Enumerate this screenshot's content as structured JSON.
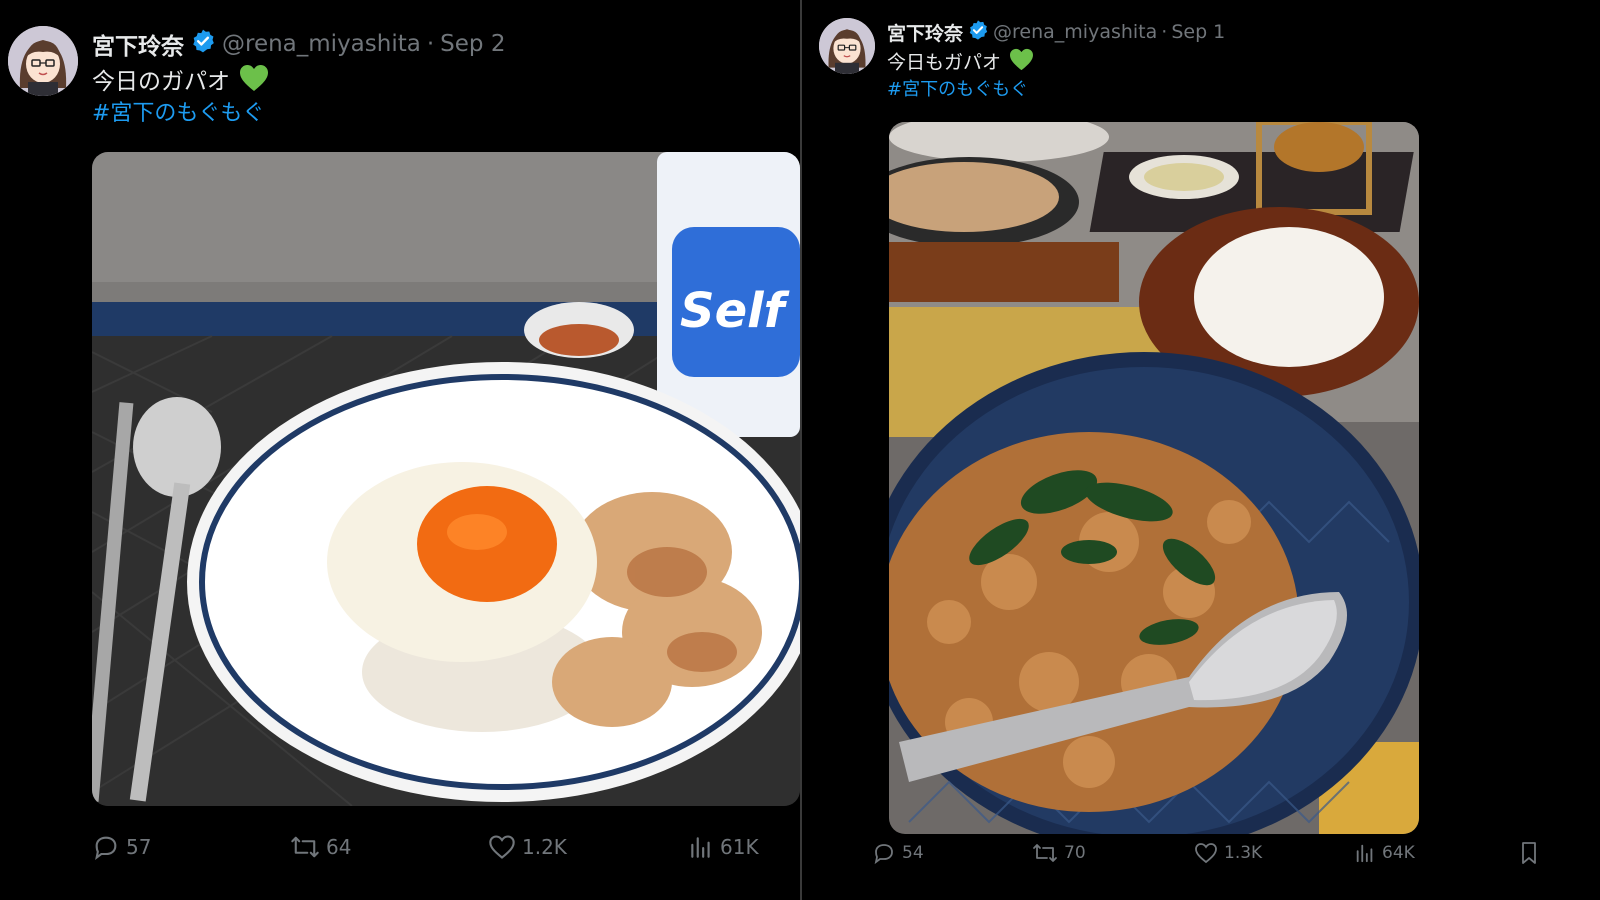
{
  "tweets": [
    {
      "author_name": "宮下玲奈",
      "handle": "@rena_miyashita",
      "separator": "·",
      "date": "Sep 2",
      "text": "今日のガパオ",
      "hashtag": "#宮下のもぐもぐ",
      "image_badge": "Self",
      "stats": {
        "replies": "57",
        "reposts": "64",
        "likes": "1.2K",
        "views": "61K"
      }
    },
    {
      "author_name": "宮下玲奈",
      "handle": "@rena_miyashita",
      "separator": "·",
      "date": "Sep 1",
      "text": "今日もガパオ",
      "hashtag": "#宮下のもぐもぐ",
      "stats": {
        "replies": "54",
        "reposts": "70",
        "likes": "1.3K",
        "views": "64K"
      }
    }
  ],
  "icons": {
    "verified": "verified-badge-icon",
    "emoji": "green-heart-icon",
    "reply": "reply-icon",
    "repost": "repost-icon",
    "like": "like-icon",
    "views": "views-icon",
    "bookmark": "bookmark-icon"
  },
  "colors": {
    "accent": "#1d9bf0",
    "muted": "#71767b",
    "emoji_green": "#6cc04a"
  }
}
